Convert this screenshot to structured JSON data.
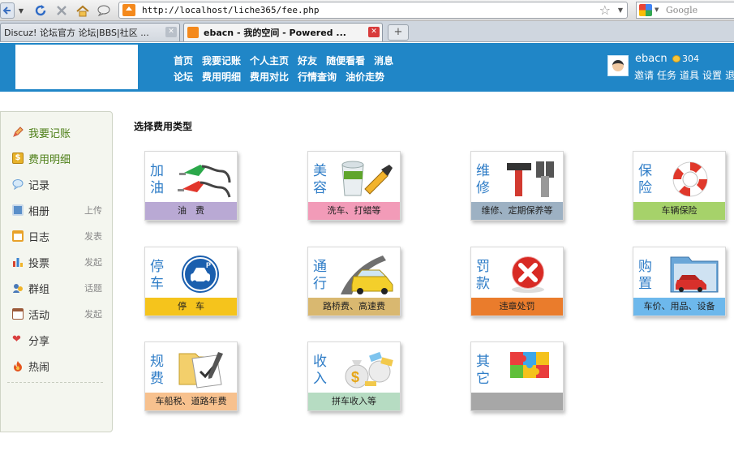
{
  "browser": {
    "url": "http://localhost/liche365/fee.php",
    "search_placeholder": "Google",
    "tabs": [
      {
        "label": "Discuz! 论坛官方 论坛|BBS|社区 ...",
        "active": false
      },
      {
        "label": "ebacn - 我的空间 - Powered ...",
        "active": true
      }
    ],
    "new_tab_label": "+"
  },
  "header": {
    "nav_row1": [
      "首页",
      "我要记账",
      "个人主页",
      "好友",
      "随便看看",
      "消息"
    ],
    "nav_row2": [
      "论坛",
      "费用明细",
      "费用对比",
      "行情查询",
      "油价走势"
    ],
    "user": {
      "name": "ebacn",
      "credits": "304",
      "menu": [
        "邀请",
        "任务",
        "道具",
        "设置",
        "退"
      ]
    }
  },
  "sidebar": {
    "items": [
      {
        "label": "我要记账",
        "extra": "",
        "icon": "pencil-icon",
        "color": "#e0604a"
      },
      {
        "label": "费用明细",
        "extra": "",
        "icon": "coin-icon",
        "color": "#e7b22a"
      },
      {
        "label": "记录",
        "extra": "",
        "icon": "speech-bubble-icon",
        "color": "#7fb0df"
      },
      {
        "label": "相册",
        "extra": "上传",
        "icon": "photo-icon",
        "color": "#5a8fc9"
      },
      {
        "label": "日志",
        "extra": "发表",
        "icon": "calendar-icon",
        "color": "#e8a22a"
      },
      {
        "label": "投票",
        "extra": "发起",
        "icon": "bar-chart-icon",
        "color": "#d7442f"
      },
      {
        "label": "群组",
        "extra": "话题",
        "icon": "group-icon",
        "color": "#4a79b8"
      },
      {
        "label": "活动",
        "extra": "发起",
        "icon": "activity-icon",
        "color": "#9b5a3a"
      },
      {
        "label": "分享",
        "extra": "",
        "icon": "hearts-icon",
        "color": "#d94040"
      },
      {
        "label": "热闹",
        "extra": "",
        "icon": "fire-icon",
        "color": "#e4561d"
      }
    ]
  },
  "main": {
    "section_title": "选择费用类型",
    "cards": [
      {
        "title": "加油",
        "bar": "油　费",
        "bar_color": "#b9a9d4",
        "icon": "fuel-nozzle-icon"
      },
      {
        "title": "美容",
        "bar": "洗车、打蜡等",
        "bar_color": "#f29bb8",
        "icon": "paint-bucket-icon"
      },
      {
        "title": "维修",
        "bar": "维修、定期保养等",
        "bar_color": "#9db1c3",
        "icon": "tools-icon"
      },
      {
        "title": "保险",
        "bar": "车辆保险",
        "bar_color": "#a6d26a",
        "icon": "lifebuoy-icon"
      },
      {
        "title": "停车",
        "bar": "停　车",
        "bar_color": "#f5c41c",
        "icon": "parking-icon"
      },
      {
        "title": "通行",
        "bar": "路桥费、高速费",
        "bar_color": "#d9b870",
        "icon": "car-road-icon"
      },
      {
        "title": "罚款",
        "bar": "违章处罚",
        "bar_color": "#ea7c2c",
        "icon": "red-cross-icon"
      },
      {
        "title": "购置",
        "bar": "车价、用品、设备",
        "bar_color": "#6db8ec",
        "icon": "folder-car-icon"
      },
      {
        "title": "规费",
        "bar": "车船税、道路年费",
        "bar_color": "#f7c18e",
        "icon": "document-check-icon"
      },
      {
        "title": "收入",
        "bar": "拼车收入等",
        "bar_color": "#b6dcc2",
        "icon": "money-bags-icon"
      },
      {
        "title": "其它",
        "bar": "",
        "bar_color": "#a7a7a7",
        "icon": "puzzle-icon"
      }
    ]
  }
}
